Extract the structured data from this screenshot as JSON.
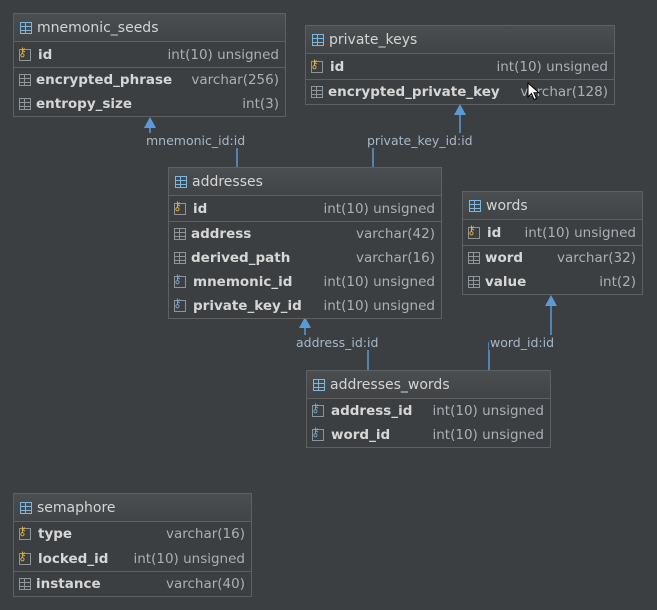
{
  "tables": {
    "mnemonic_seeds": {
      "name": "mnemonic_seeds",
      "columns": [
        {
          "name": "id",
          "type": "int(10) unsigned",
          "key": "pk"
        },
        {
          "name": "encrypted_phrase",
          "type": "varchar(256)"
        },
        {
          "name": "entropy_size",
          "type": "int(3)"
        }
      ]
    },
    "private_keys": {
      "name": "private_keys",
      "columns": [
        {
          "name": "id",
          "type": "int(10) unsigned",
          "key": "pk"
        },
        {
          "name": "encrypted_private_key",
          "type": "varchar(128)"
        }
      ]
    },
    "addresses": {
      "name": "addresses",
      "columns": [
        {
          "name": "id",
          "type": "int(10) unsigned",
          "key": "pk"
        },
        {
          "name": "address",
          "type": "varchar(42)"
        },
        {
          "name": "derived_path",
          "type": "varchar(16)"
        },
        {
          "name": "mnemonic_id",
          "type": "int(10) unsigned",
          "key": "fk"
        },
        {
          "name": "private_key_id",
          "type": "int(10) unsigned",
          "key": "fk"
        }
      ]
    },
    "words": {
      "name": "words",
      "columns": [
        {
          "name": "id",
          "type": "int(10) unsigned",
          "key": "pk"
        },
        {
          "name": "word",
          "type": "varchar(32)"
        },
        {
          "name": "value",
          "type": "int(2)"
        }
      ]
    },
    "addresses_words": {
      "name": "addresses_words",
      "columns": [
        {
          "name": "address_id",
          "type": "int(10) unsigned",
          "key": "fk"
        },
        {
          "name": "word_id",
          "type": "int(10) unsigned",
          "key": "fk"
        }
      ]
    },
    "semaphore": {
      "name": "semaphore",
      "columns": [
        {
          "name": "type",
          "type": "varchar(16)",
          "key": "pk"
        },
        {
          "name": "locked_id",
          "type": "int(10) unsigned",
          "key": "pk"
        },
        {
          "name": "instance",
          "type": "varchar(40)"
        }
      ]
    }
  },
  "relations": {
    "mnemonic": "mnemonic_id:id",
    "private_key": "private_key_id:id",
    "address": "address_id:id",
    "word": "word_id:id"
  },
  "colors": {
    "background": "#3c3f41",
    "link": "#5b9bd5",
    "primary_key": "#e0b23a",
    "foreign_key": "#6fa8dc"
  }
}
